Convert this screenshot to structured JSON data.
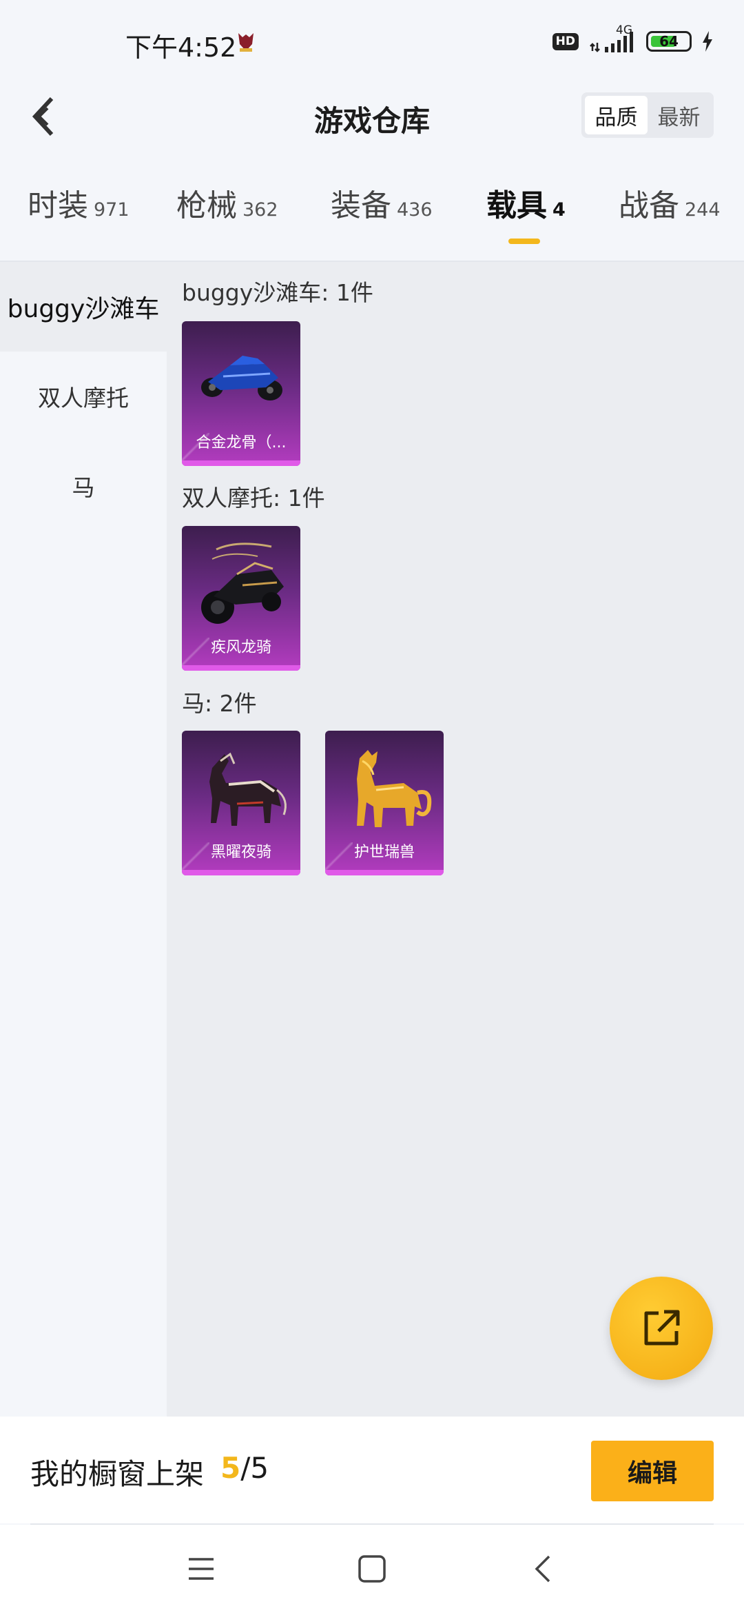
{
  "status_bar": {
    "time": "下午4:52",
    "hd": "HD",
    "network": "4G",
    "battery": "64"
  },
  "header": {
    "title": "游戏仓库",
    "sort_options": [
      "品质",
      "最新"
    ],
    "sort_active": "品质"
  },
  "tabs": [
    {
      "label": "时装",
      "count": "971"
    },
    {
      "label": "枪械",
      "count": "362"
    },
    {
      "label": "装备",
      "count": "436"
    },
    {
      "label": "载具",
      "count": "4",
      "active": true
    },
    {
      "label": "战备",
      "count": "244"
    }
  ],
  "sidebar": {
    "items": [
      {
        "label": "buggy沙滩车",
        "active": true
      },
      {
        "label": "双人摩托"
      },
      {
        "label": "马"
      }
    ]
  },
  "groups": [
    {
      "title": "buggy沙滩车: 1件",
      "items": [
        {
          "name": "合金龙骨（...",
          "icon": "buggy-car-icon"
        }
      ]
    },
    {
      "title": "双人摩托: 1件",
      "items": [
        {
          "name": "疾风龙骑",
          "icon": "motorcycle-icon"
        }
      ]
    },
    {
      "title": "马: 2件",
      "items": [
        {
          "name": "黑曜夜骑",
          "icon": "dark-horse-icon"
        },
        {
          "name": "护世瑞兽",
          "icon": "golden-beast-icon"
        }
      ]
    }
  ],
  "fab": {
    "icon": "share-external-icon"
  },
  "showcase": {
    "label": "我的橱窗上架",
    "current": "5",
    "total": "/5"
  },
  "edit_label": "编辑",
  "colors": {
    "accent": "#f3b71c",
    "card_purple": "#6a2b83",
    "card_magenta": "#b43cc0"
  }
}
